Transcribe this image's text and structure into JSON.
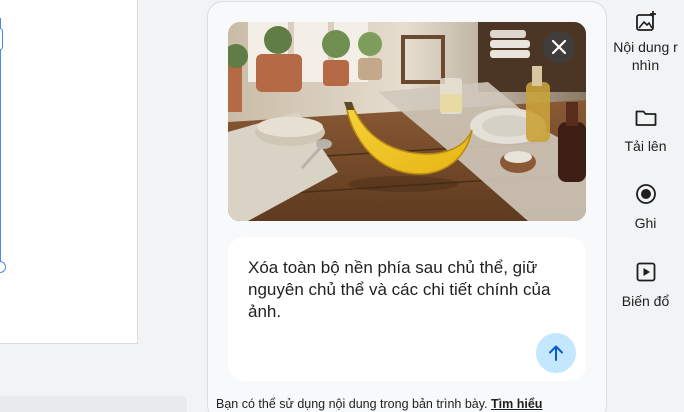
{
  "panel": {
    "prompt_text": "Xóa toàn bộ nền phía sau chủ thể, giữ nguyên chủ thể và các chi tiết chính của ảnh.",
    "footer_text": "Bạn có thể sử dụng nội dung trong bản trình bày.",
    "footer_link": "Tìm hiểu"
  },
  "rail": {
    "items": [
      {
        "label_line1": "Nội dung r",
        "label_line2": "nhìn",
        "icon": "add-photo-icon"
      },
      {
        "label_line1": "Tải lên",
        "icon": "folder-icon"
      },
      {
        "label_line1": "Ghi",
        "icon": "record-icon"
      },
      {
        "label_line1": "Biến đổ",
        "icon": "video-play-icon"
      }
    ]
  },
  "colors": {
    "accent": "#4a89f3",
    "send_button": "#c2e7ff",
    "panel_bg": "#f8f9fa"
  }
}
